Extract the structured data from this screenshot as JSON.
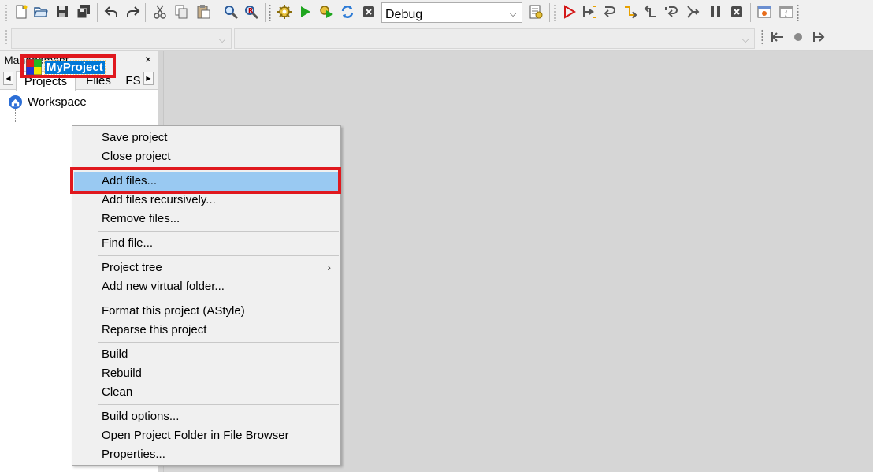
{
  "toolbar": {
    "build_target": "Debug",
    "icons": [
      "new-file-icon",
      "open-icon",
      "save-icon",
      "save-all-icon",
      "undo-icon",
      "redo-icon",
      "cut-icon",
      "copy-icon",
      "paste-icon",
      "find-icon",
      "replace-icon",
      "build-icon",
      "run-icon",
      "build-run-icon",
      "rebuild-icon",
      "abort-icon",
      "build-target-icon",
      "debug-icon",
      "run-to-cursor-icon",
      "next-line-icon",
      "step-into-icon",
      "step-out-icon",
      "next-instruction-icon",
      "step-into-instruction-icon",
      "break-debugger-icon",
      "stop-debugger-icon",
      "debug-windows-icon",
      "info-icon",
      "jump-back-icon",
      "toggle-bookmark-icon",
      "jump-forward-icon"
    ]
  },
  "management": {
    "title": "Management",
    "close_glyph": "×",
    "tabs": [
      "Projects",
      "Files",
      "FS"
    ],
    "workspace_label": "Workspace",
    "project_label": "MyProject"
  },
  "context_menu": {
    "items": [
      "Save project",
      "Close project",
      "Add files...",
      "Add files recursively...",
      "Remove files...",
      "Find file...",
      "Project tree",
      "Add new virtual folder...",
      "Format this project (AStyle)",
      "Reparse this project",
      "Build",
      "Rebuild",
      "Clean",
      "Build options...",
      "Open Project Folder in File Browser",
      "Properties..."
    ],
    "highlighted": "Add files...",
    "submenu_arrow": "›"
  },
  "colors": {
    "annotation_red": "#e0181e",
    "menu_highlight": "#99c9f2",
    "selection_blue": "#0078d7"
  }
}
